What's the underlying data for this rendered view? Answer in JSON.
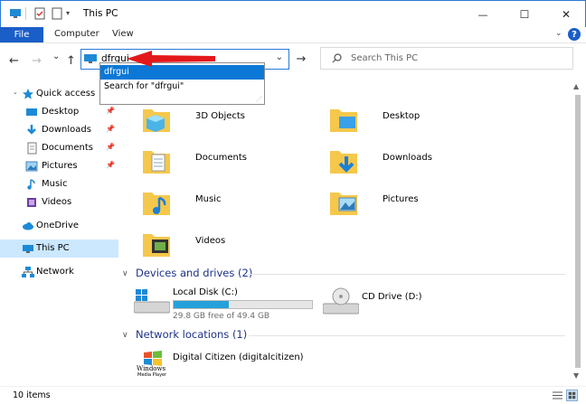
{
  "window": {
    "title": "This PC",
    "minimize_glyph": "—",
    "maximize_glyph": "☐",
    "close_glyph": "✕",
    "accent": "#1a5ec8"
  },
  "ribbon": {
    "file": "File",
    "tabs": [
      "Computer",
      "View"
    ],
    "help": "?"
  },
  "nav": {
    "back": "←",
    "forward": "→",
    "recent": "⌄",
    "up": "↑",
    "address_value": "dfrgui",
    "go": "→"
  },
  "search": {
    "placeholder": "Search This PC",
    "icon": "search-icon"
  },
  "autocomplete": {
    "items": [
      "dfrgui",
      "Search for \"dfrgui\""
    ]
  },
  "sidebar": {
    "quick_access": "Quick access",
    "items": [
      {
        "label": "Desktop",
        "icon": "desktop-icon",
        "pinned": true
      },
      {
        "label": "Downloads",
        "icon": "downloads-icon",
        "pinned": true
      },
      {
        "label": "Documents",
        "icon": "documents-icon",
        "pinned": true
      },
      {
        "label": "Pictures",
        "icon": "pictures-icon",
        "pinned": true
      },
      {
        "label": "Music",
        "icon": "music-icon",
        "pinned": false
      },
      {
        "label": "Videos",
        "icon": "videos-icon",
        "pinned": false
      }
    ],
    "onedrive": "OneDrive",
    "this_pc": "This PC",
    "network": "Network"
  },
  "content": {
    "folders": [
      {
        "label": "3D Objects",
        "icon": "3d-objects-folder-icon"
      },
      {
        "label": "Desktop",
        "icon": "desktop-folder-icon"
      },
      {
        "label": "Documents",
        "icon": "documents-folder-icon"
      },
      {
        "label": "Downloads",
        "icon": "downloads-folder-icon"
      },
      {
        "label": "Music",
        "icon": "music-folder-icon"
      },
      {
        "label": "Pictures",
        "icon": "pictures-folder-icon"
      },
      {
        "label": "Videos",
        "icon": "videos-folder-icon"
      }
    ],
    "devices_header": "Devices and drives (2)",
    "drives": [
      {
        "label": "Local Disk (C:)",
        "free": "29.8 GB free of 49.4 GB",
        "used_fraction": 0.4
      },
      {
        "label": "CD Drive (D:)"
      }
    ],
    "network_header": "Network locations (1)",
    "network_locations": [
      {
        "label": "Digital Citizen (digitalcitizen)",
        "icon_caption": "Windows",
        "icon_subcaption": "Media Player"
      }
    ]
  },
  "status": {
    "items_count": "10 items"
  }
}
